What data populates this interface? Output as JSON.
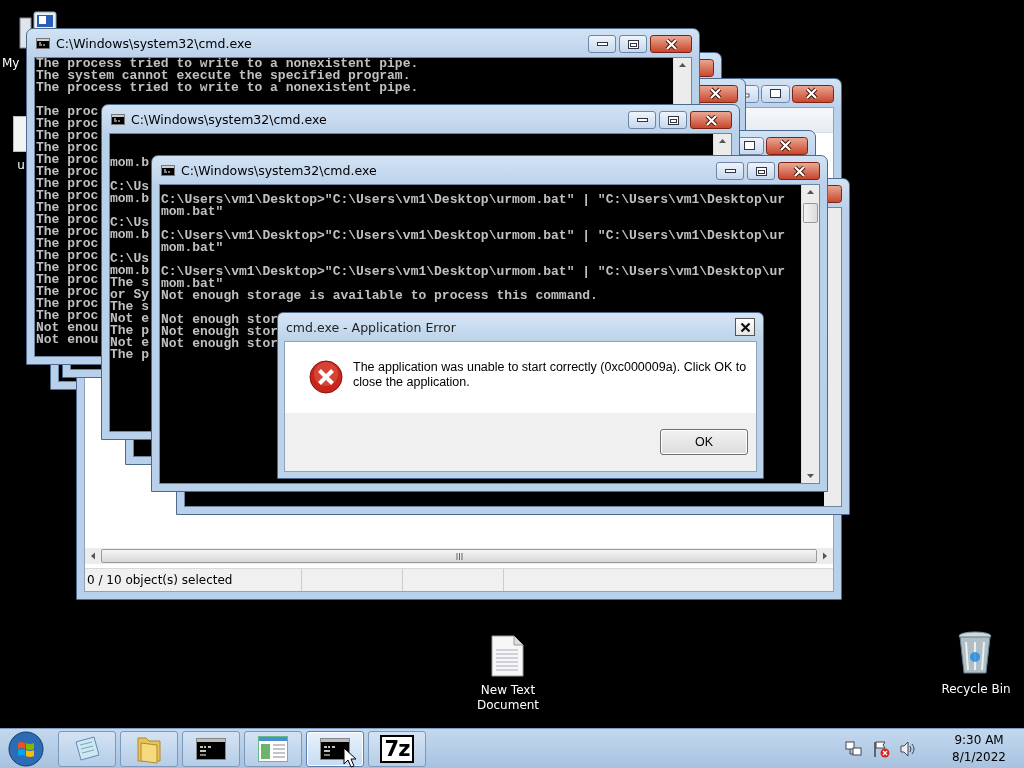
{
  "desktop_icons": [
    {
      "kind": "computer",
      "label": "My"
    },
    {
      "kind": "file",
      "label": "u"
    },
    {
      "kind": "text-file",
      "label": "New Text Document"
    },
    {
      "kind": "recycle-bin",
      "label": "Recycle Bin"
    }
  ],
  "windows": [
    {
      "kind": "cmd"
    },
    {
      "kind": "explorer",
      "status_bar": "0 / 10 object(s) selected"
    },
    {
      "kind": "cmd"
    },
    {
      "kind": "cmd"
    },
    {
      "kind": "cmd"
    },
    {
      "kind": "cmd",
      "title": "C:\\Windows\\system32\\cmd.exe",
      "blocks": [
        [
          "The process tried to write to a nonexistent pipe.",
          "The system cannot execute the specified program.",
          "The process tried to write to a nonexistent pipe."
        ],
        [
          "The proc",
          "The proc",
          "The proc",
          "The proc",
          "The proc",
          "The proc",
          "The proc",
          "The proc",
          "The proc",
          "The proc",
          "The proc",
          "The proc",
          "The proc",
          "The proc",
          "The proc",
          "The proc",
          "The proc",
          "The proc",
          "Not enou",
          "Not enou"
        ]
      ]
    },
    {
      "kind": "cmd",
      "title": "C:\\Windows\\system32\\cmd.exe",
      "blocks": [
        [
          "mom.b"
        ],
        [
          "C:\\Us",
          "mom.b"
        ],
        [
          "C:\\Us",
          "mom.b"
        ],
        [
          "C:\\Us",
          "mom.b",
          "The s",
          "or Sy",
          "The s",
          "Not e",
          "The p",
          "Not e",
          "The p"
        ]
      ]
    },
    {
      "kind": "cmd",
      "title": "C:\\Windows\\system32\\cmd.exe",
      "blocks": [
        [
          "C:\\Users\\vm1\\Desktop>\"C:\\Users\\vm1\\Desktop\\urmom.bat\" | \"C:\\Users\\vm1\\Desktop\\ur",
          "mom.bat\""
        ],
        [
          "C:\\Users\\vm1\\Desktop>\"C:\\Users\\vm1\\Desktop\\urmom.bat\" | \"C:\\Users\\vm1\\Desktop\\ur",
          "mom.bat\""
        ],
        [
          "C:\\Users\\vm1\\Desktop>\"C:\\Users\\vm1\\Desktop\\urmom.bat\" | \"C:\\Users\\vm1\\Desktop\\ur",
          "mom.bat\"",
          "Not enough storage is available to process this command."
        ],
        [
          "Not enough stor",
          "Not enough stor",
          "Not enough stor"
        ]
      ]
    }
  ],
  "dialog": {
    "title": "cmd.exe - Application Error",
    "message": "The application was unable to start correctly (0xc000009a). Click OK to close the application.",
    "buttons": [
      "OK"
    ]
  },
  "taskbar": {
    "items": [
      {
        "kind": "notepad",
        "selected": false
      },
      {
        "kind": "folder",
        "selected": false
      },
      {
        "kind": "console",
        "selected": false
      },
      {
        "kind": "window",
        "selected": false
      },
      {
        "kind": "console",
        "selected": true
      },
      {
        "kind": "archiver",
        "label": "7z",
        "selected": false
      }
    ],
    "time": "9:30 AM",
    "date": "8/1/2022"
  }
}
